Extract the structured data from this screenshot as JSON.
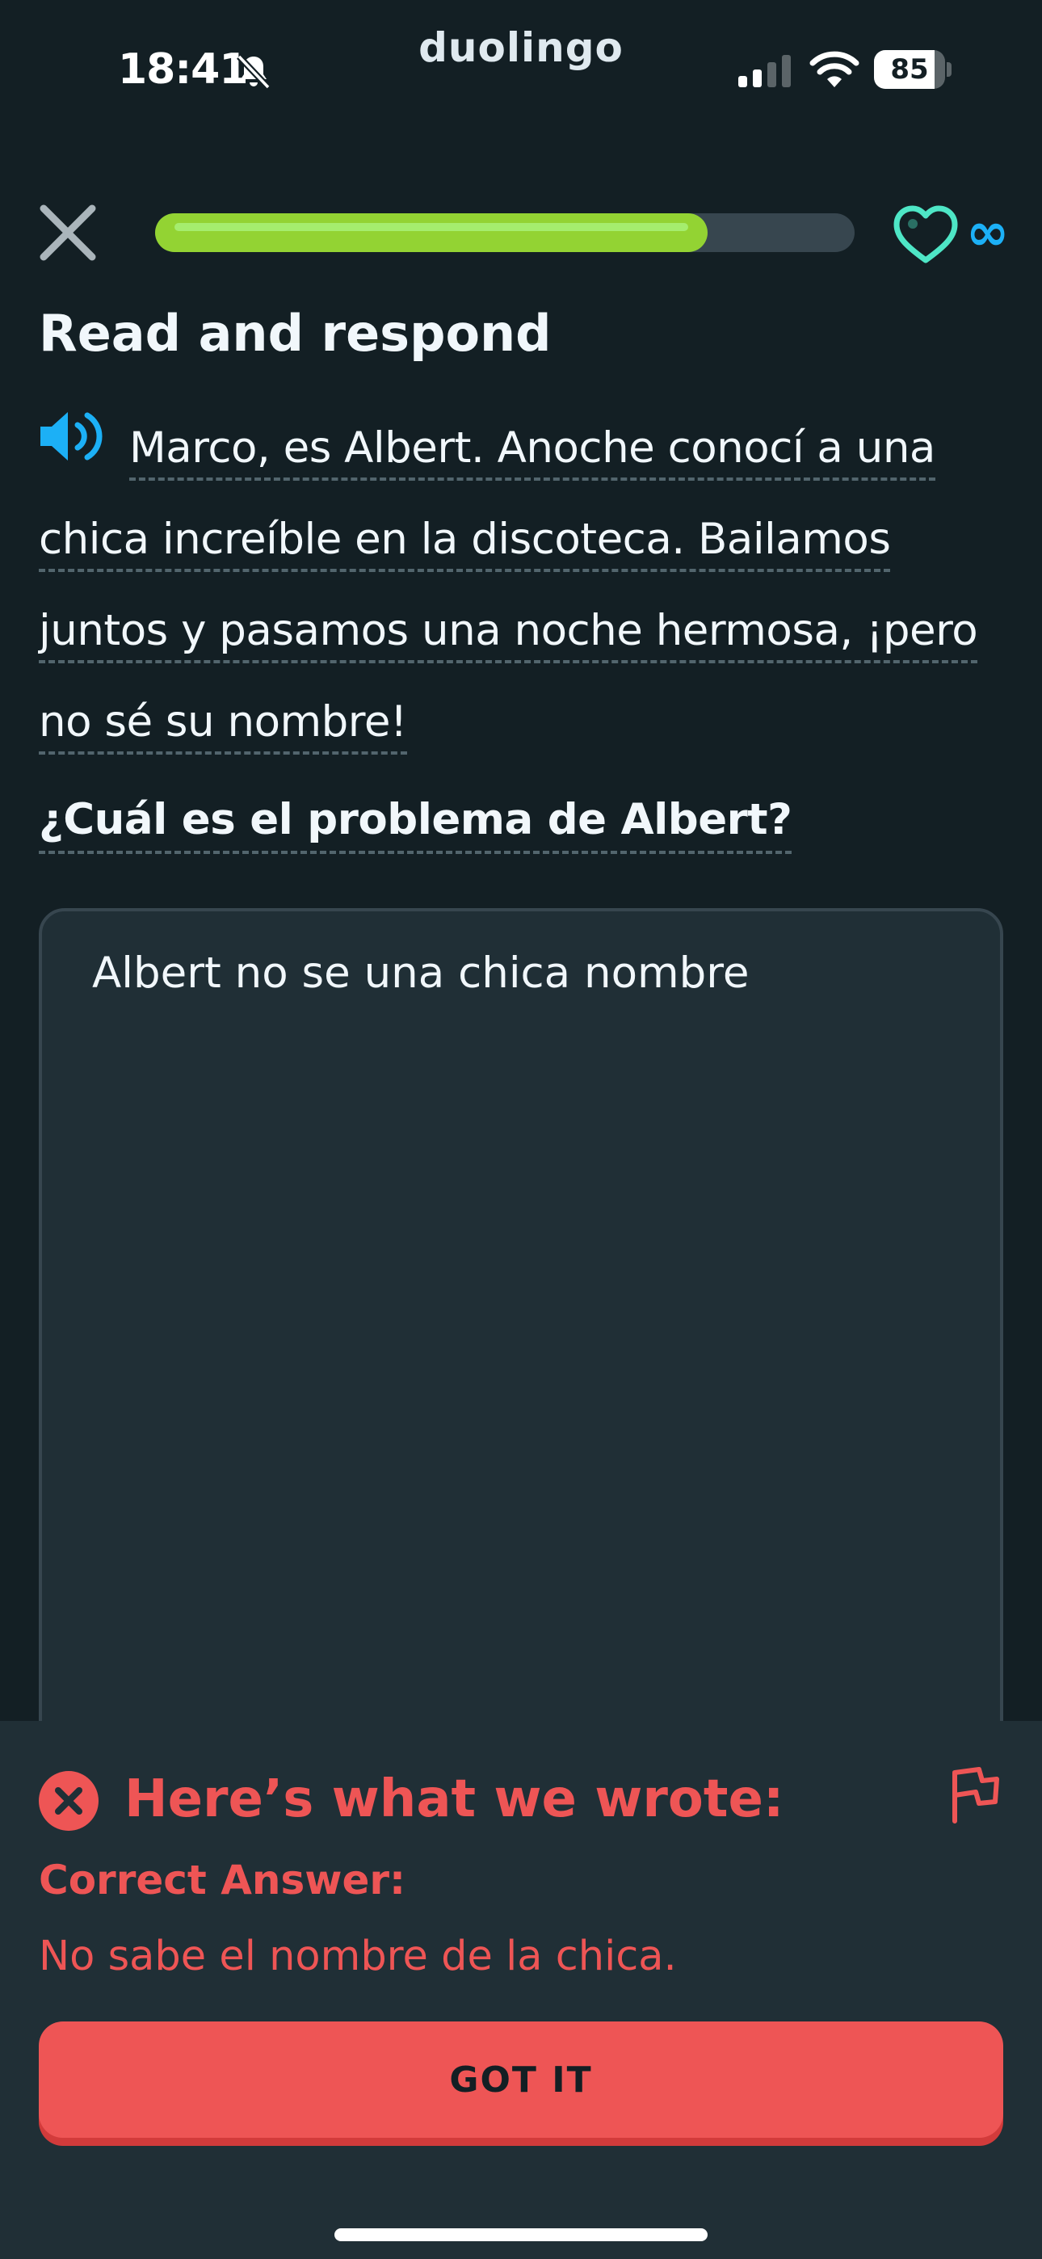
{
  "status_bar": {
    "time": "18:41",
    "bell_icon": "bell-slash-icon",
    "brand": "duolingo",
    "battery_level": 85,
    "battery_text": "85"
  },
  "lesson": {
    "progress": 0.79,
    "close_icon": "close-icon",
    "heart_icon": "heart-icon",
    "hearts_label": "∞"
  },
  "challenge": {
    "title": "Read and respond",
    "passage_line1": "Marco, es Albert. Anoche conocí a una",
    "passage_line2": "chica increíble en la discoteca. Bailamos",
    "passage_line3": "juntos y pasamos una noche hermosa, ¡pero",
    "passage_line4": "no sé su nombre!",
    "question": "¿Cuál es el problema de Albert?",
    "answer_value": "Albert no se una chica nombre"
  },
  "feedback": {
    "title": "Here’s what we wrote:",
    "correct_label": "Correct Answer:",
    "correct_answer": "No sabe el nombre de la chica.",
    "button_label": "GOT IT"
  },
  "colors": {
    "background": "#131f24",
    "panel": "#202f36",
    "progress": "#93d333",
    "error": "#ee5555",
    "accent_blue": "#1cb0f6",
    "heart_teal": "#4ee6c6"
  }
}
